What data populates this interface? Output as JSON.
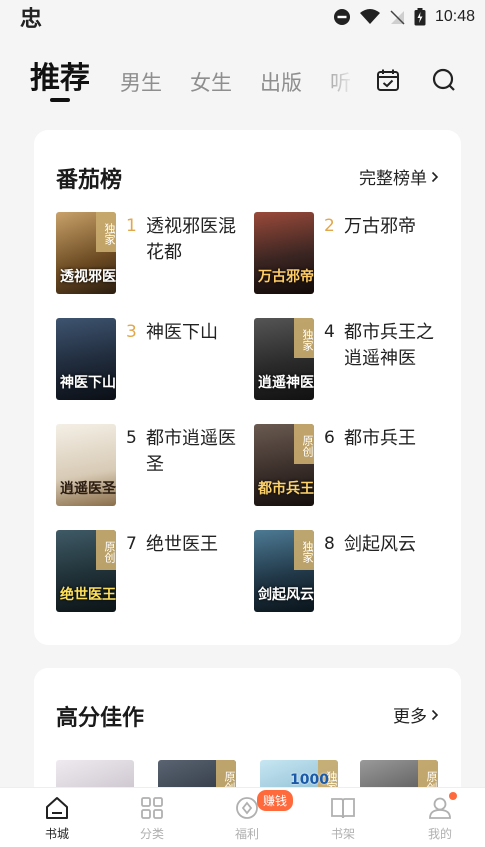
{
  "status_bar": {
    "left_glyph": "忠",
    "time": "10:48"
  },
  "top_tabs": [
    {
      "label": "推荐",
      "active": true
    },
    {
      "label": "男生",
      "active": false
    },
    {
      "label": "女生",
      "active": false
    },
    {
      "label": "出版",
      "active": false
    },
    {
      "label": "听",
      "active": false
    }
  ],
  "ranking": {
    "title": "番茄榜",
    "more_label": "完整榜单",
    "books": [
      {
        "rank": "1",
        "title": "透视邪医混花都",
        "tag": "独家",
        "cover_text": "透视邪医",
        "color": "#7a5a2e"
      },
      {
        "rank": "2",
        "title": "万古邪帝",
        "tag": "",
        "cover_text": "万古邪帝",
        "color": "#3a2522"
      },
      {
        "rank": "3",
        "title": "神医下山",
        "tag": "",
        "cover_text": "神医下山",
        "color": "#1f2a3a"
      },
      {
        "rank": "4",
        "title": "都市兵王之逍遥神医",
        "tag": "独家",
        "cover_text": "逍遥神医",
        "color": "#2a2a2a"
      },
      {
        "rank": "5",
        "title": "都市逍遥医圣",
        "tag": "",
        "cover_text": "逍遥医圣",
        "color": "#e6ddd0"
      },
      {
        "rank": "6",
        "title": "都市兵王",
        "tag": "原创",
        "cover_text": "都市兵王",
        "color": "#3b2f2b"
      },
      {
        "rank": "7",
        "title": "绝世医王",
        "tag": "原创",
        "cover_text": "绝世医王",
        "color": "#1f3036"
      },
      {
        "rank": "8",
        "title": "剑起风云",
        "tag": "独家",
        "cover_text": "剑起风云",
        "color": "#213848"
      }
    ]
  },
  "high_score": {
    "title": "高分佳作",
    "more_label": "更多",
    "thumbs": [
      {
        "tag": "",
        "color": "#d9d4da"
      },
      {
        "tag": "原创",
        "color": "#2c3440"
      },
      {
        "tag": "独家",
        "color": "#8fc3d9",
        "text": "1000"
      },
      {
        "tag": "原创",
        "color": "#6d6d6d"
      }
    ]
  },
  "bottom_nav": [
    {
      "label": "书城",
      "active": true
    },
    {
      "label": "分类",
      "active": false
    },
    {
      "label": "福利",
      "active": false,
      "badge": "赚钱"
    },
    {
      "label": "书架",
      "active": false
    },
    {
      "label": "我的",
      "active": false,
      "dot": true
    }
  ],
  "colors": {
    "accent": "#ff6a3d",
    "rank_gold": "#e2a74b",
    "tag_bg": "#c8aa6e"
  }
}
